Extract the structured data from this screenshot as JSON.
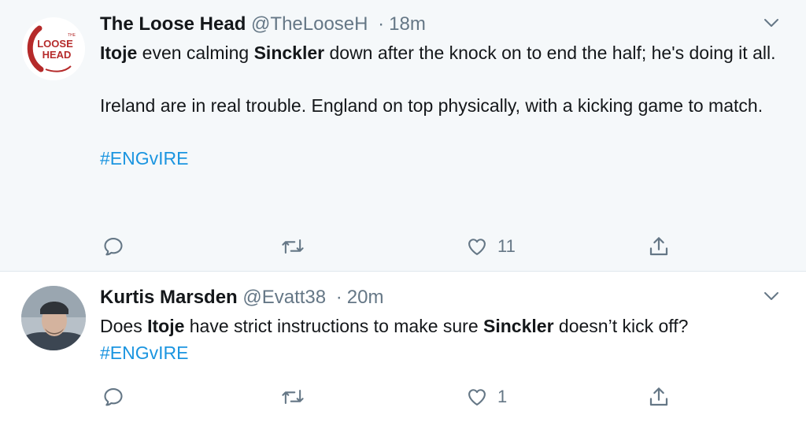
{
  "tweets": [
    {
      "author_name": "The Loose Head",
      "handle": "@TheLooseH",
      "separator": "·",
      "time": "18m",
      "avatar_logo": {
        "small_text": "THE",
        "line1": "LOOSE",
        "line2": "HEAD"
      },
      "body": [
        {
          "bold1": "Itoje",
          "t1": " even calming ",
          "bold2": "Sinckler",
          "t2": " down after the knock on to end the half; he's doing it all."
        },
        {
          "text": "Ireland are in real trouble. England on top physically, with a kicking game to match."
        }
      ],
      "hashtag": "#ENGvIRE",
      "likes": "11"
    },
    {
      "author_name": "Kurtis Marsden",
      "handle": "@Evatt38",
      "separator": "·",
      "time": "20m",
      "body": {
        "t0": "Does ",
        "bold1": "Itoje",
        "t1": " have strict instructions to make sure ",
        "bold2": "Sinckler",
        "t2": " doesn’t kick off?"
      },
      "hashtag": "#ENGvIRE",
      "likes": "1"
    }
  ],
  "colors": {
    "text": "#14171a",
    "muted": "#657786",
    "link": "#1b95e0",
    "highlight_bg": "#f5f8fa",
    "logo_red": "#b52a2a"
  },
  "icons": [
    "reply-icon",
    "retweet-icon",
    "like-icon",
    "share-icon",
    "chevron-down-icon"
  ]
}
